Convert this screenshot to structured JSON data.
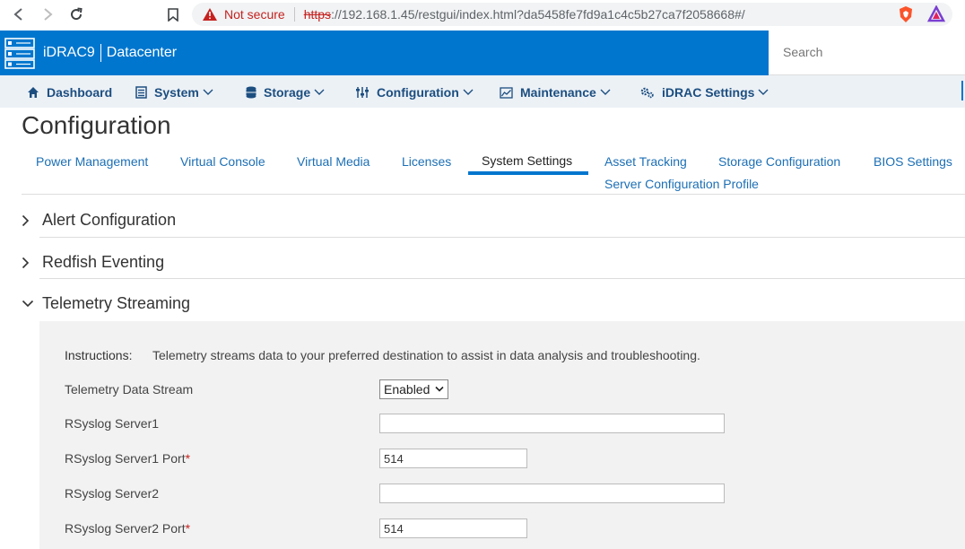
{
  "browser": {
    "not_secure": "Not secure",
    "url_scheme": "https",
    "url_rest": "://192.168.1.45/restgui/index.html?da5458fe7fd9a1c4c5b27ca7f2058668#/"
  },
  "header": {
    "brand": "iDRAC9",
    "edition": "Datacenter",
    "search_placeholder": "Search",
    "accent": "#0076ce"
  },
  "menu": {
    "items": [
      {
        "label": "Dashboard",
        "icon": "home-icon"
      },
      {
        "label": "System",
        "icon": "server-icon"
      },
      {
        "label": "Storage",
        "icon": "database-icon"
      },
      {
        "label": "Configuration",
        "icon": "sliders-icon"
      },
      {
        "label": "Maintenance",
        "icon": "chart-icon"
      },
      {
        "label": "iDRAC Settings",
        "icon": "gears-icon"
      }
    ]
  },
  "page": {
    "title": "Configuration",
    "tabs": [
      {
        "label": "Power Management"
      },
      {
        "label": "Virtual Console"
      },
      {
        "label": "Virtual Media"
      },
      {
        "label": "Licenses"
      },
      {
        "label": "System Settings",
        "active": true
      },
      {
        "label": "Asset Tracking"
      },
      {
        "label": "Storage Configuration"
      },
      {
        "label": "BIOS Settings"
      },
      {
        "label": "Server Configuration Profile"
      }
    ]
  },
  "sections": [
    {
      "title": "Alert Configuration",
      "expanded": false
    },
    {
      "title": "Redfish Eventing",
      "expanded": false
    },
    {
      "title": "Telemetry Streaming",
      "expanded": true
    }
  ],
  "telemetry": {
    "instructions_label": "Instructions:",
    "instructions_text": "Telemetry streams data to your preferred destination to assist in data analysis and troubleshooting.",
    "stream_label": "Telemetry Data Stream",
    "stream_value": "Enabled",
    "server1_label": "RSyslog Server1",
    "server1_value": "",
    "server1_port_label": "RSyslog Server1 Port",
    "server1_port_value": "514",
    "server2_label": "RSyslog Server2",
    "server2_value": "",
    "server2_port_label": "RSyslog Server2 Port",
    "server2_port_value": "514",
    "required_mark": "*"
  }
}
